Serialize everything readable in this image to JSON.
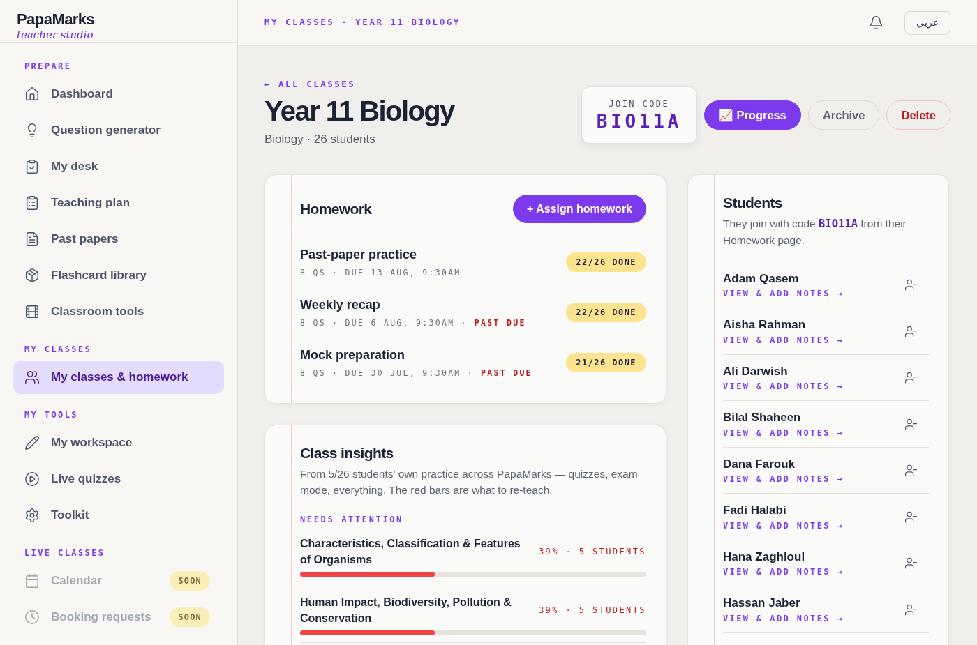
{
  "sidebar": {
    "brand": "PapaMarks",
    "tagline": "teacher studio",
    "sections": [
      {
        "heading": "PREPARE",
        "items": [
          {
            "label": "Dashboard",
            "selected": false,
            "disabled": false
          },
          {
            "label": "Question generator",
            "selected": false,
            "disabled": false
          },
          {
            "label": "My desk",
            "selected": false,
            "disabled": false
          },
          {
            "label": "Teaching plan",
            "selected": false,
            "disabled": false
          },
          {
            "label": "Past papers",
            "selected": false,
            "disabled": false
          },
          {
            "label": "Flashcard library",
            "selected": false,
            "disabled": false
          },
          {
            "label": "Classroom tools",
            "selected": false,
            "disabled": false
          }
        ]
      },
      {
        "heading": "MY CLASSES",
        "items": [
          {
            "label": "My classes & homework",
            "selected": true,
            "disabled": false
          }
        ]
      },
      {
        "heading": "MY TOOLS",
        "items": [
          {
            "label": "My workspace",
            "selected": false,
            "disabled": false
          },
          {
            "label": "Live quizzes",
            "selected": false,
            "disabled": false
          },
          {
            "label": "Toolkit",
            "selected": false,
            "disabled": false
          }
        ]
      },
      {
        "heading": "LIVE CLASSES",
        "items": [
          {
            "label": "Calendar",
            "selected": false,
            "disabled": true,
            "badge": "SOON"
          },
          {
            "label": "Booking requests",
            "selected": false,
            "disabled": true,
            "badge": "SOON"
          }
        ]
      }
    ]
  },
  "topbar": {
    "breadcrumb": "MY CLASSES · YEAR 11 BIOLOGY",
    "language": "عربي"
  },
  "header": {
    "back_link": "← ALL CLASSES",
    "title": "Year 11 Biology",
    "subtitle": "Biology · 26 students",
    "join_code_label": "JOIN CODE",
    "join_code": "BIO11A",
    "actions": [
      {
        "label": "📈 Progress",
        "kind": "primary"
      },
      {
        "label": "Archive",
        "kind": "neutral"
      },
      {
        "label": "Delete",
        "kind": "danger"
      }
    ]
  },
  "homework": {
    "title": "Homework",
    "button": "+ Assign homework",
    "items": [
      {
        "title": "Past-paper practice",
        "meta": "8 QS · DUE 13 AUG, 9:30AM",
        "badge": "22/26 DONE"
      },
      {
        "title": "Weekly recap",
        "meta": "8 QS · DUE 6 AUG, 9:30AM ·",
        "past_due": "PAST DUE",
        "badge": "22/26 DONE"
      },
      {
        "title": "Mock preparation",
        "meta": "8 QS · DUE 30 JUL, 9:30AM ·",
        "past_due": "PAST DUE",
        "badge": "21/26 DONE"
      }
    ]
  },
  "insights": {
    "title": "Class insights",
    "description": "From 5/26 students' own practice across PapaMarks — quizzes, exam mode, everything. The red bars are what to re-teach.",
    "section_label": "NEEDS ATTENTION",
    "topics": [
      {
        "topic": "Characteristics, Classification & Features of Organisms",
        "stat": "39% · 5 STUDENTS",
        "level": 0.39
      },
      {
        "topic": "Human Impact, Biodiversity, Pollution & Conservation",
        "stat": "39% · 5 STUDENTS",
        "level": 0.39
      }
    ]
  },
  "students": {
    "title": "Students",
    "description": "They join with code **BIO11A** from their Homework page.",
    "items": [
      {
        "name": "Adam Qasem",
        "link": "VIEW & ADD NOTES →"
      },
      {
        "name": "Aisha Rahman",
        "link": "VIEW & ADD NOTES →"
      },
      {
        "name": "Ali Darwish",
        "link": "VIEW & ADD NOTES →"
      },
      {
        "name": "Bilal Shaheen",
        "link": "VIEW & ADD NOTES →"
      },
      {
        "name": "Dana Farouk",
        "link": "VIEW & ADD NOTES →"
      },
      {
        "name": "Fadi Halabi",
        "link": "VIEW & ADD NOTES →"
      },
      {
        "name": "Hana Zaghloul",
        "link": "VIEW & ADD NOTES →"
      },
      {
        "name": "Hassan Jaber",
        "link": "VIEW & ADD NOTES →"
      }
    ]
  }
}
